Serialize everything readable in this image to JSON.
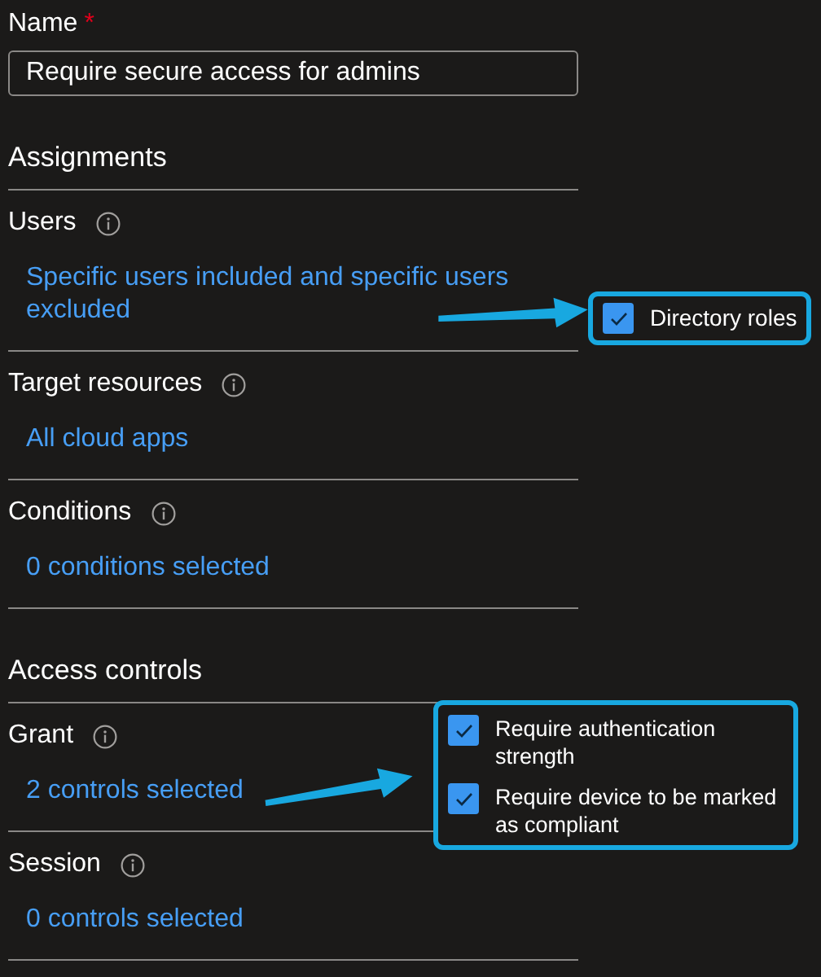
{
  "name_field": {
    "label": "Name",
    "required_mark": "*",
    "value": "Require secure access for admins"
  },
  "sections": [
    {
      "heading": "Assignments",
      "items": [
        {
          "label": "Users",
          "value": "Specific users included and specific users excluded",
          "callout": [
            {
              "label": "Directory roles",
              "checked": true
            }
          ]
        },
        {
          "label": "Target resources",
          "value": "All cloud apps"
        },
        {
          "label": "Conditions",
          "value": "0 conditions selected"
        }
      ]
    },
    {
      "heading": "Access controls",
      "items": [
        {
          "label": "Grant",
          "value": "2 controls selected",
          "callout": [
            {
              "label": "Require authentication strength",
              "checked": true
            },
            {
              "label": "Require device to be marked as compliant",
              "checked": true
            }
          ]
        },
        {
          "label": "Session",
          "value": "0 controls selected"
        }
      ]
    }
  ]
}
